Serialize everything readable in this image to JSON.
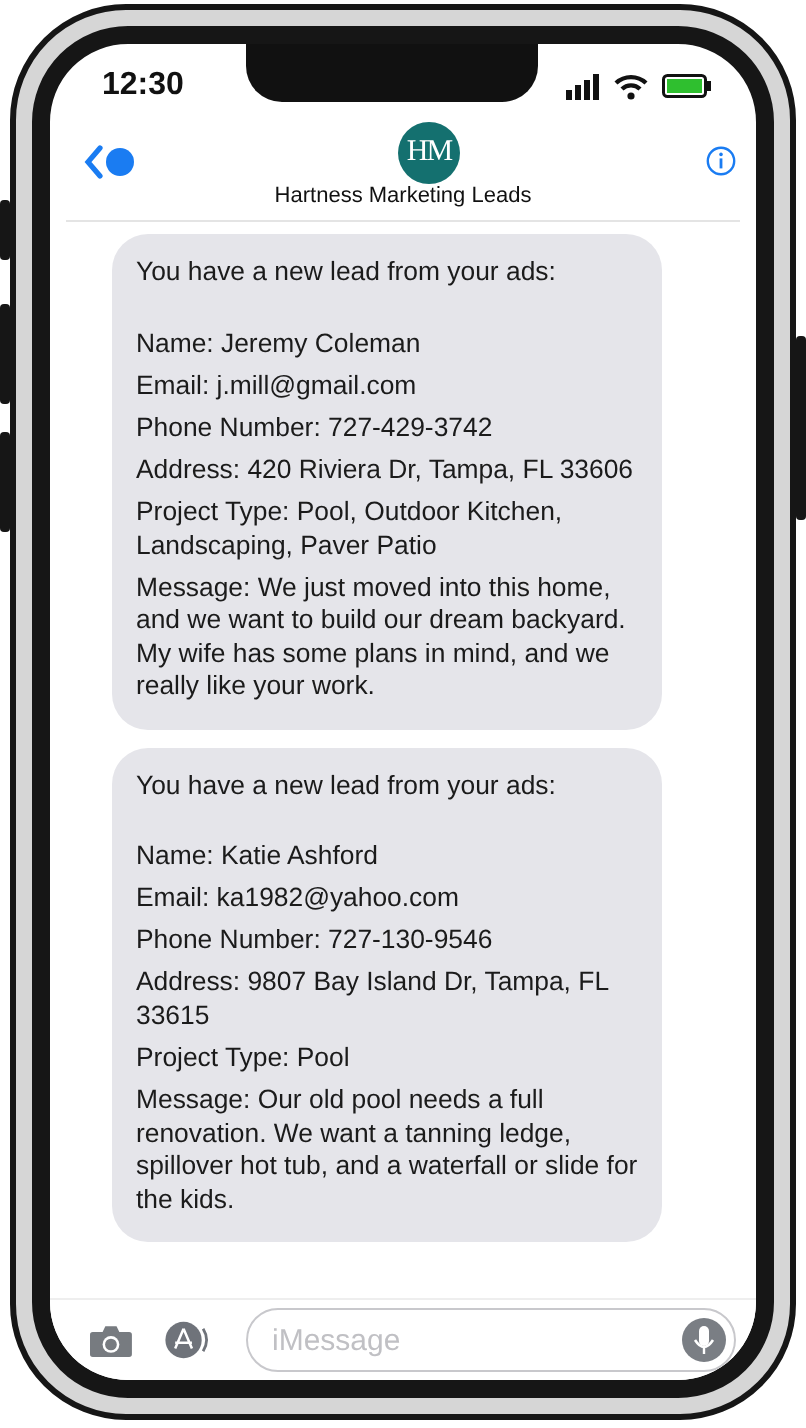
{
  "status_bar": {
    "time": "12:30"
  },
  "header": {
    "logo": "HM",
    "contact": "Hartness Marketing Leads"
  },
  "messages": [
    {
      "intro": "You have a new lead from your ads:",
      "fields": [
        "Name: Jeremy Coleman",
        "Email: j.mill@gmail.com",
        "Phone Number: 727-429-3742",
        "Address: 420 Riviera Dr, Tampa, FL 33606",
        "Project Type: Pool, Outdoor Kitchen, Landscaping, Paver Patio",
        "Message: We just moved into this home, and we want to build our dream backyard. My wife has some plans in mind, and we really like your work."
      ]
    },
    {
      "intro": "You have a new lead from your ads:",
      "fields": [
        "Name: Katie Ashford",
        "Email: ka1982@yahoo.com",
        "Phone Number: 727-130-9546",
        "Address: 9807 Bay Island Dr, Tampa, FL 33615",
        "Project Type: Pool",
        "Message: Our old pool needs a full renovation. We want a tanning ledge, spillover hot tub, and a waterfall or slide for the kids."
      ]
    }
  ],
  "composer": {
    "placeholder": "iMessage"
  }
}
